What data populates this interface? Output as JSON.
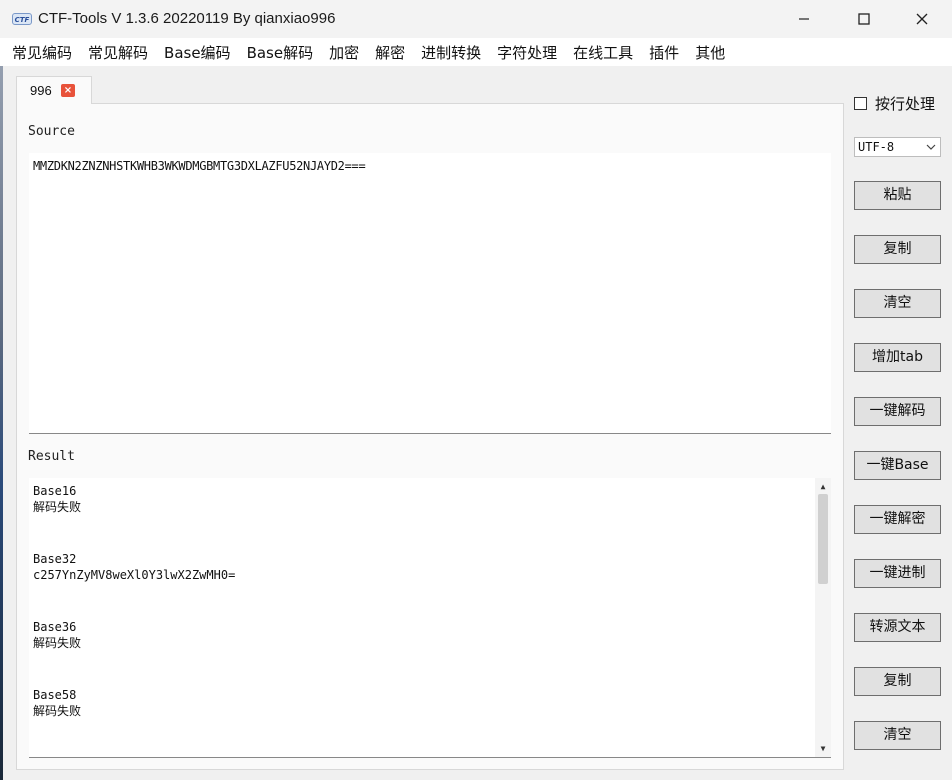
{
  "window": {
    "title": "CTF-Tools V 1.3.6 20220119 By qianxiao996",
    "icon_text": "CTF"
  },
  "menu": [
    "常见编码",
    "常见解码",
    "Base编码",
    "Base解码",
    "加密",
    "解密",
    "进制转换",
    "字符处理",
    "在线工具",
    "插件",
    "其他"
  ],
  "tab": {
    "label": "996",
    "close_symbol": "×"
  },
  "source": {
    "label": "Source",
    "value": "MMZDKN2ZNZNHSTKWHB3WKWDMGBMTG3DXLAZFU52NJAYD2==="
  },
  "result": {
    "label": "Result",
    "entries": [
      {
        "name": "Base16",
        "value": "解码失败"
      },
      {
        "name": "Base32",
        "value": "c257YnZyMV8weXl0Y3lwX2ZwMH0="
      },
      {
        "name": "Base36",
        "value": "解码失败"
      },
      {
        "name": "Base58",
        "value": "解码失败"
      }
    ]
  },
  "sidebar": {
    "line_process_label": "按行处理",
    "line_process_checked": false,
    "encoding_selected": "UTF-8",
    "buttons": [
      "粘贴",
      "复制",
      "清空",
      "增加tab",
      "一键解码",
      "一键Base",
      "一键解密",
      "一键进制",
      "转源文本",
      "复制",
      "清空"
    ]
  },
  "icons": {
    "minimize": "minimize-icon",
    "maximize": "maximize-icon",
    "close": "close-icon",
    "chevron": "chevron-down-icon"
  }
}
